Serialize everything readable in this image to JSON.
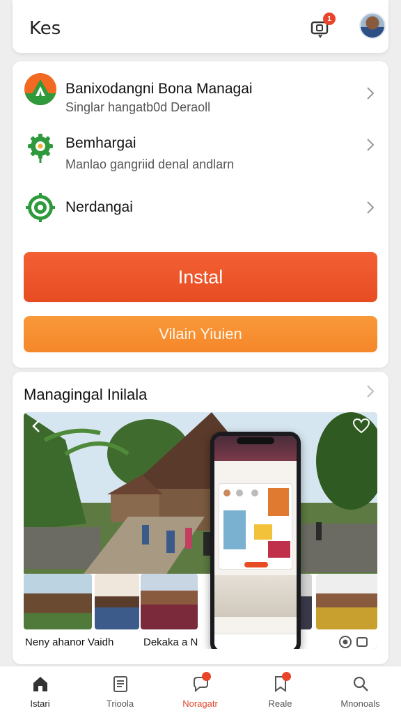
{
  "header": {
    "title": "Kes",
    "notification_count": "1"
  },
  "list": {
    "items": [
      {
        "title": "Banixodangni Bona Managai",
        "subtitle": "Singlar hangatb0d Deraoll",
        "icon": "app-logo-icon"
      },
      {
        "title": "Bemhargai",
        "subtitle": "Manlao gangriid denal andlarn",
        "icon": "gear-icon"
      },
      {
        "title": "Nerdangai",
        "subtitle": "",
        "icon": "badge-gear-icon"
      }
    ]
  },
  "buttons": {
    "install": "Instal",
    "secondary": "Vilain Yiuien"
  },
  "gallery": {
    "title": "Managingal Inilala",
    "captions": [
      "Neny ahanor Vaidh",
      "Dekaka a N"
    ]
  },
  "tabbar": {
    "items": [
      {
        "label": "Istari",
        "icon": "home-icon",
        "active": true
      },
      {
        "label": "Trioola",
        "icon": "document-icon",
        "active": false
      },
      {
        "label": "Noragatr",
        "icon": "chat-icon",
        "active": false
      },
      {
        "label": "Reale",
        "icon": "bookmark-icon",
        "active": false
      },
      {
        "label": "Mnonoals",
        "icon": "search-icon",
        "active": false
      }
    ]
  },
  "colors": {
    "primary": "#e84c22",
    "secondary": "#f5872a",
    "tab_active_label": "#e0452a"
  }
}
